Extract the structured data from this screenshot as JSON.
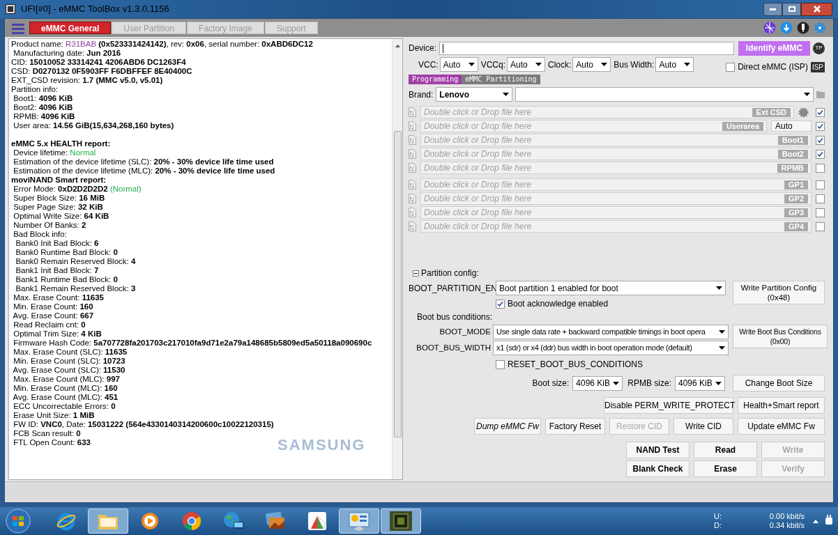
{
  "window": {
    "title": "UFI[#0] - eMMC ToolBox v1.3.0.1156"
  },
  "tabs": [
    {
      "label": "eMMC General",
      "selected": true
    },
    {
      "label": "User Partition",
      "selected": false
    },
    {
      "label": "Factory Image",
      "selected": false
    },
    {
      "label": "Support",
      "selected": false
    }
  ],
  "log": {
    "sections": [
      [
        [
          {
            "text": "Product name: ",
            "kind": "label"
          },
          {
            "text": "R31BAB",
            "kind": "model"
          },
          {
            "text": " (0x523331424142)",
            "kind": "value"
          },
          {
            "text": ", rev: ",
            "kind": "label"
          },
          {
            "text": "0x06",
            "kind": "value"
          },
          {
            "text": ", serial number: ",
            "kind": "label"
          },
          {
            "text": "0xABD6DC12",
            "kind": "value"
          }
        ],
        [
          {
            "text": " Manufacturing date: ",
            "kind": "label"
          },
          {
            "text": "Jun 2016",
            "kind": "value"
          }
        ],
        [
          {
            "text": "CID: ",
            "kind": "label"
          },
          {
            "text": "15010052 33314241 4206ABD6 DC1263F4",
            "kind": "value"
          }
        ],
        [
          {
            "text": "CSD: ",
            "kind": "label"
          },
          {
            "text": "D0270132 0F5903FF F6DBFFEF 8E40400C",
            "kind": "value"
          }
        ],
        [
          {
            "text": "EXT_CSD revision: ",
            "kind": "label"
          },
          {
            "text": "1.7 (MMC v5.0, v5.01)",
            "kind": "value"
          }
        ],
        [
          {
            "text": "Partition info:",
            "kind": "label"
          }
        ],
        [
          {
            "text": " Boot1: ",
            "kind": "label"
          },
          {
            "text": "4096 KiB",
            "kind": "value"
          }
        ],
        [
          {
            "text": " Boot2: ",
            "kind": "label"
          },
          {
            "text": "4096 KiB",
            "kind": "value"
          }
        ],
        [
          {
            "text": " RPMB: ",
            "kind": "label"
          },
          {
            "text": "4096 KiB",
            "kind": "value"
          }
        ],
        [
          {
            "text": " User area: ",
            "kind": "label"
          },
          {
            "text": "14.56 GiB(15,634,268,160 bytes)",
            "kind": "value"
          }
        ]
      ],
      [
        [
          {
            "text": "eMMC 5.x HEALTH report:",
            "kind": "value"
          }
        ],
        [
          {
            "text": " Device lifetime: ",
            "kind": "label"
          },
          {
            "text": "Normal",
            "kind": "status"
          }
        ],
        [
          {
            "text": " Estimation of the device lifetime (SLC): ",
            "kind": "label"
          },
          {
            "text": "20% - 30% device life time used",
            "kind": "value"
          }
        ],
        [
          {
            "text": " Estimation of the device lifetime (MLC): ",
            "kind": "label"
          },
          {
            "text": "20% - 30% device life time used",
            "kind": "value"
          }
        ],
        [
          {
            "text": "moviNAND Smart report:",
            "kind": "value"
          }
        ],
        [
          {
            "text": " Error Mode: ",
            "kind": "label"
          },
          {
            "text": "0xD2D2D2D2",
            "kind": "value"
          },
          {
            "text": " (Normal)",
            "kind": "status"
          }
        ],
        [
          {
            "text": " Super Block Size: ",
            "kind": "label"
          },
          {
            "text": "16 MiB",
            "kind": "value"
          }
        ],
        [
          {
            "text": " Super Page Size: ",
            "kind": "label"
          },
          {
            "text": "32 KiB",
            "kind": "value"
          }
        ],
        [
          {
            "text": " Optimal Write Size: ",
            "kind": "label"
          },
          {
            "text": "64 KiB",
            "kind": "value"
          }
        ],
        [
          {
            "text": " Number Of Banks: ",
            "kind": "label"
          },
          {
            "text": "2",
            "kind": "value"
          }
        ],
        [
          {
            "text": " Bad Block info:",
            "kind": "label"
          }
        ],
        [
          {
            "text": "  Bank0 Init Bad Block: ",
            "kind": "label"
          },
          {
            "text": "6",
            "kind": "value"
          }
        ],
        [
          {
            "text": "  Bank0 Runtime Bad Block: ",
            "kind": "label"
          },
          {
            "text": "0",
            "kind": "value"
          }
        ],
        [
          {
            "text": "  Bank0 Remain Reserved Block: ",
            "kind": "label"
          },
          {
            "text": "4",
            "kind": "value"
          }
        ],
        [
          {
            "text": "  Bank1 Init Bad Block: ",
            "kind": "label"
          },
          {
            "text": "7",
            "kind": "value"
          }
        ],
        [
          {
            "text": "  Bank1 Runtime Bad Block: ",
            "kind": "label"
          },
          {
            "text": "0",
            "kind": "value"
          }
        ],
        [
          {
            "text": "  Bank1 Remain Reserved Block: ",
            "kind": "label"
          },
          {
            "text": "3",
            "kind": "value"
          }
        ],
        [
          {
            "text": " Max. Erase Count: ",
            "kind": "label"
          },
          {
            "text": "11635",
            "kind": "value"
          }
        ],
        [
          {
            "text": " Min. Erase Count: ",
            "kind": "label"
          },
          {
            "text": "160",
            "kind": "value"
          }
        ],
        [
          {
            "text": " Avg. Erase Count: ",
            "kind": "label"
          },
          {
            "text": "667",
            "kind": "value"
          }
        ],
        [
          {
            "text": " Read Reclaim cnt: ",
            "kind": "label"
          },
          {
            "text": "0",
            "kind": "value"
          }
        ],
        [
          {
            "text": " Optimal Trim Size: ",
            "kind": "label"
          },
          {
            "text": "4 KiB",
            "kind": "value"
          }
        ],
        [
          {
            "text": " Firmware Hash Code: ",
            "kind": "label"
          },
          {
            "text": "5a707728fa201703c217010fa9d71e2a79a148685b5809ed5a50118a090690c",
            "kind": "value"
          }
        ],
        [
          {
            "text": " Max. Erase Count (SLC): ",
            "kind": "label"
          },
          {
            "text": "11635",
            "kind": "value"
          }
        ],
        [
          {
            "text": " Min. Erase Count (SLC): ",
            "kind": "label"
          },
          {
            "text": "10723",
            "kind": "value"
          }
        ],
        [
          {
            "text": " Avg. Erase Count (SLC): ",
            "kind": "label"
          },
          {
            "text": "11530",
            "kind": "value"
          }
        ],
        [
          {
            "text": " Max. Erase Count (MLC): ",
            "kind": "label"
          },
          {
            "text": "997",
            "kind": "value"
          }
        ],
        [
          {
            "text": " Min. Erase Count (MLC): ",
            "kind": "label"
          },
          {
            "text": "160",
            "kind": "value"
          }
        ],
        [
          {
            "text": " Avg. Erase Count (MLC): ",
            "kind": "label"
          },
          {
            "text": "451",
            "kind": "value"
          }
        ],
        [
          {
            "text": " ECC Uncorrectable Errors: ",
            "kind": "label"
          },
          {
            "text": "0",
            "kind": "value"
          }
        ],
        [
          {
            "text": " Erase Unit Size: ",
            "kind": "label"
          },
          {
            "text": "1 MiB",
            "kind": "value"
          }
        ],
        [
          {
            "text": " FW ID: ",
            "kind": "label"
          },
          {
            "text": "VNC0",
            "kind": "value"
          },
          {
            "text": ", Date: ",
            "kind": "label"
          },
          {
            "text": "15031222 (564e4330140314200600c10022120315)",
            "kind": "value"
          }
        ],
        [
          {
            "text": " FCB Scan result: ",
            "kind": "label"
          },
          {
            "text": "0",
            "kind": "value"
          }
        ],
        [
          {
            "text": " FTL Open Count: ",
            "kind": "label"
          },
          {
            "text": "633",
            "kind": "value"
          }
        ]
      ]
    ],
    "vendor_logo": "SAMSUNG"
  },
  "device": {
    "label": "Device:",
    "button": "Identify eMMC",
    "tp_badge": "TP"
  },
  "power": [
    {
      "label": "VCC:",
      "value": "Auto"
    },
    {
      "label": "VCCq:",
      "value": "Auto"
    },
    {
      "label": "Clock:",
      "value": "Auto"
    },
    {
      "label": "Bus Width:",
      "value": "Auto"
    }
  ],
  "direct": {
    "label": "Direct eMMC (ISP)",
    "checked": false,
    "badge": "ISP"
  },
  "subtabs": [
    {
      "label": "Programming",
      "selected": true
    },
    {
      "label": "eMMC Partitioning",
      "selected": false
    }
  ],
  "brand": {
    "label": "Brand:",
    "value": "Lenovo"
  },
  "file_rows": [
    {
      "placeholder": "Double click or Drop file here",
      "tag": "Ext CSD",
      "kind": "extcsd",
      "checked": true
    },
    {
      "placeholder": "Double click or Drop file here",
      "tag": "Userarea",
      "kind": "size",
      "size": "Auto",
      "checked": true
    },
    {
      "placeholder": "Double click or Drop file here",
      "tag": "Boot1",
      "kind": "plain",
      "checked": true
    },
    {
      "placeholder": "Double click or Drop file here",
      "tag": "Boot2",
      "kind": "plain",
      "checked": true
    },
    {
      "placeholder": "Double click or Drop file here",
      "tag": "RPMB",
      "kind": "plain",
      "checked": false
    }
  ],
  "gp_rows": [
    {
      "placeholder": "Double click or Drop file here",
      "tag": "GP1",
      "checked": false
    },
    {
      "placeholder": "Double click or Drop file here",
      "tag": "GP2",
      "checked": false
    },
    {
      "placeholder": "Double click or Drop file here",
      "tag": "GP3",
      "checked": false
    },
    {
      "placeholder": "Double click or Drop file here",
      "tag": "GP4",
      "checked": false
    }
  ],
  "partition_config": {
    "title": "Partition config:",
    "expanded": true,
    "boot_partition_label": "BOOT_PARTITION_EN",
    "boot_partition_value": "Boot partition 1 enabled for boot",
    "write_config_button": [
      "Write Partition Config",
      "(0x48)"
    ],
    "boot_ack": {
      "label": "Boot acknowledge enabled",
      "checked": true
    },
    "bus_title": "Boot bus conditions:",
    "boot_mode_label": "BOOT_MODE",
    "boot_mode_value": "Use single data rate + backward compatible timings in boot opera",
    "bus_width_label": "BOOT_BUS_WIDTH",
    "bus_width_value": "x1 (sdr) or x4 (ddr) bus width in boot operation mode (default)",
    "write_bus_button": [
      "Write Boot Bus Conditions",
      "(0x00)"
    ],
    "reset": {
      "label": "RESET_BOOT_BUS_CONDITIONS",
      "checked": false
    },
    "boot_size_label": "Boot size:",
    "boot_size": "4096 KiB",
    "rpmb_size_label": "RPMB size:",
    "rpmb_size": "4096 KiB",
    "change_button": "Change Boot Size"
  },
  "action_rows": [
    [
      {
        "label": "Disable PERM_WRITE_PROTECT",
        "disabled": false,
        "italic": false
      },
      {
        "label": "Health+Smart report",
        "disabled": false,
        "italic": false
      }
    ],
    [
      {
        "label": "Dump eMMC Fw",
        "disabled": false,
        "italic": true
      },
      {
        "label": "Factory Reset",
        "disabled": false,
        "italic": false
      },
      {
        "label": "Restore CID",
        "disabled": true,
        "italic": false
      },
      {
        "label": "Write CID",
        "disabled": false,
        "italic": false
      },
      {
        "label": "Update eMMC Fw",
        "disabled": false,
        "italic": false
      }
    ]
  ],
  "main_buttons": [
    [
      {
        "label": "NAND Test",
        "disabled": false
      },
      {
        "label": "Read",
        "disabled": false
      },
      {
        "label": "Write",
        "disabled": true
      }
    ],
    [
      {
        "label": "Blank Check",
        "disabled": false
      },
      {
        "label": "Erase",
        "disabled": false
      },
      {
        "label": "Verify",
        "disabled": true
      }
    ]
  ],
  "taskbar": {
    "items": [
      {
        "kind": "ie",
        "active": false
      },
      {
        "kind": "folder",
        "active": true
      },
      {
        "kind": "media",
        "active": false
      },
      {
        "kind": "chrome",
        "active": false
      },
      {
        "kind": "globe",
        "active": false
      },
      {
        "kind": "photos",
        "active": false
      },
      {
        "kind": "slices",
        "active": false
      },
      {
        "kind": "panel",
        "active": true
      },
      {
        "kind": "chip",
        "active": true
      }
    ],
    "tray": [
      {
        "label": "U:",
        "value": "0.00 kbit/s"
      },
      {
        "label": "D:",
        "value": "0.34 kbit/s"
      }
    ]
  }
}
